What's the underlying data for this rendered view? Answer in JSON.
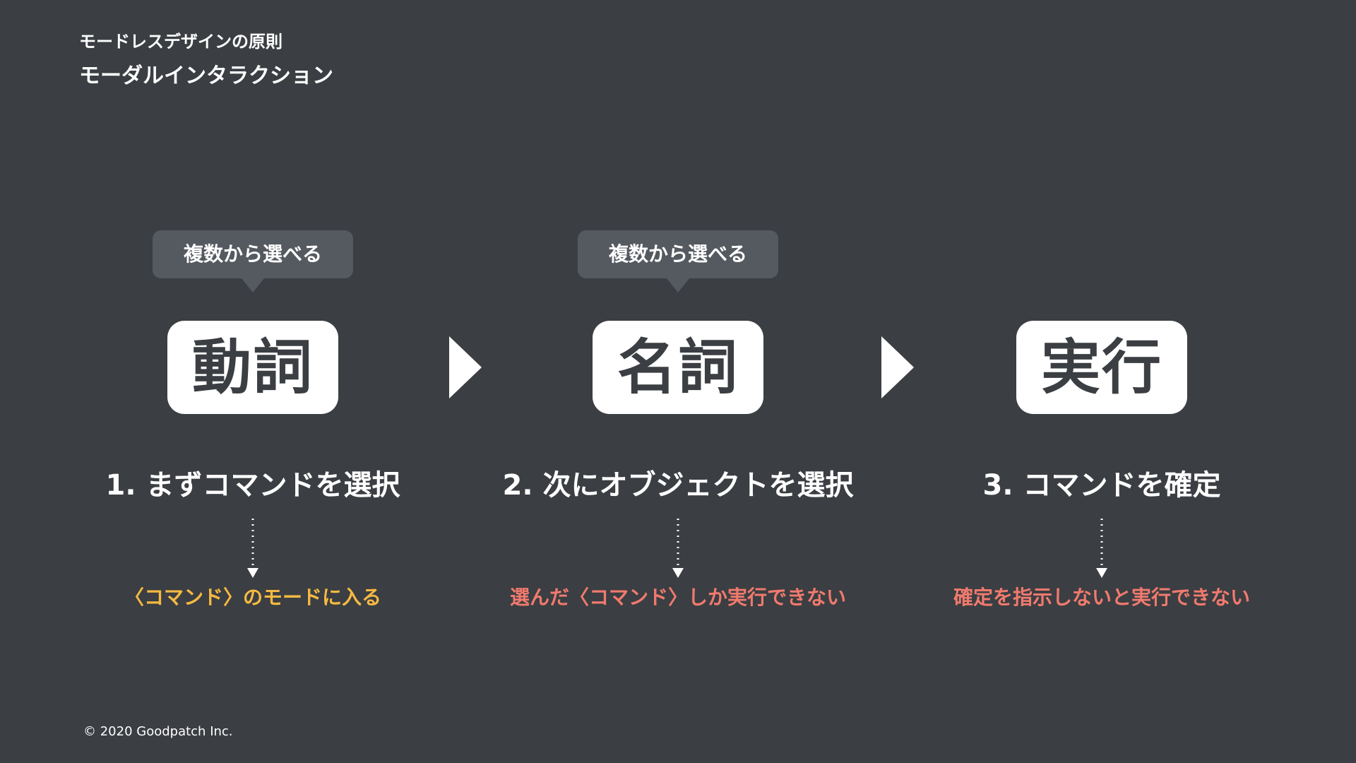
{
  "header": {
    "subtitle": "モードレスデザインの原則",
    "title": "モーダルインタラクション"
  },
  "steps": [
    {
      "tooltip": "複数から選べる",
      "card": "動詞",
      "label": "1. まずコマンドを選択",
      "note": "〈コマンド〉のモードに入る",
      "note_color": "#f5b942"
    },
    {
      "tooltip": "複数から選べる",
      "card": "名詞",
      "label": "2. 次にオブジェクトを選択",
      "note": "選んだ〈コマンド〉しか実行できない",
      "note_color": "#f07a6e"
    },
    {
      "tooltip": "",
      "card": "実行",
      "label": "3. コマンドを確定",
      "note": "確定を指示しないと実行できない",
      "note_color": "#f07a6e"
    }
  ],
  "colors": {
    "background": "#3b3e42",
    "tooltip": "#555a61",
    "card": "#ffffff",
    "card_text": "#3b3e42",
    "accent_yellow": "#f5b942",
    "accent_red": "#f07a6e"
  },
  "footer": {
    "copyright": "© 2020 Goodpatch Inc."
  }
}
